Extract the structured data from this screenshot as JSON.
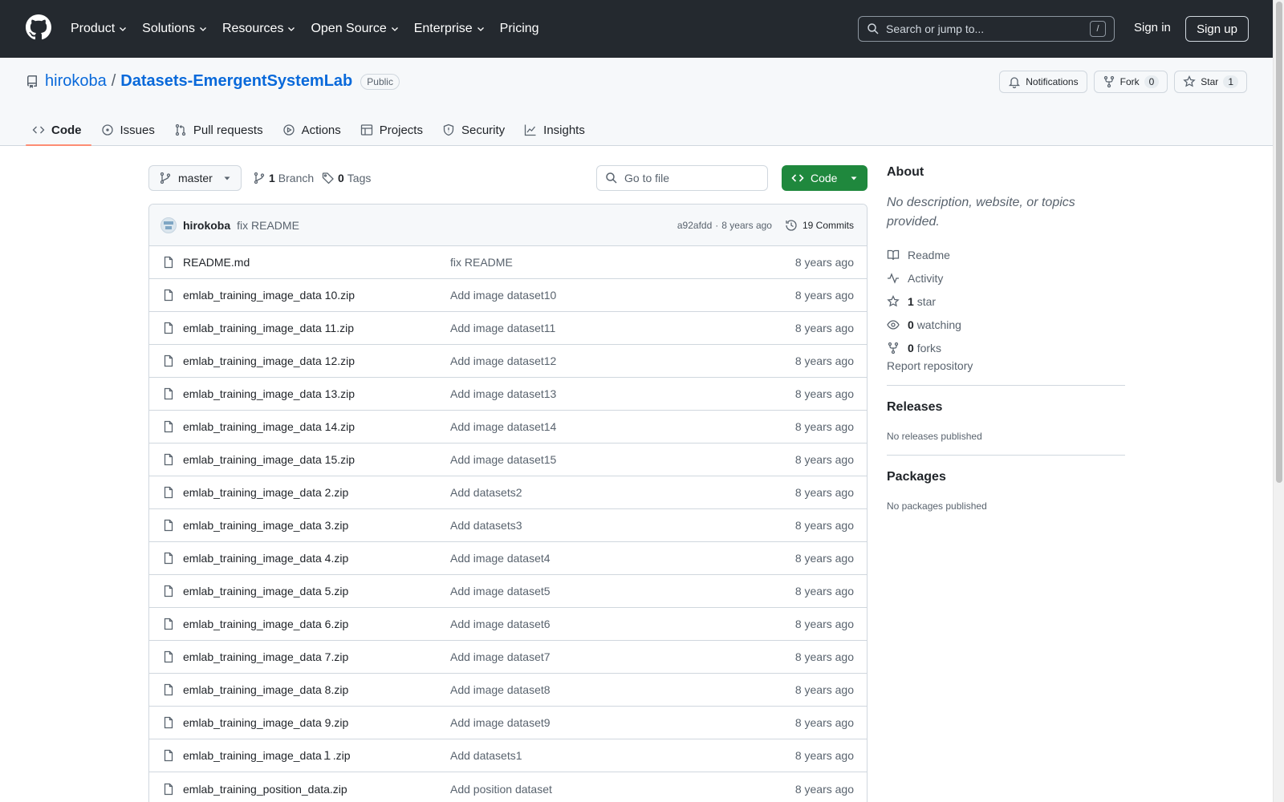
{
  "header": {
    "nav": [
      {
        "label": "Product",
        "dropdown": true
      },
      {
        "label": "Solutions",
        "dropdown": true
      },
      {
        "label": "Resources",
        "dropdown": true
      },
      {
        "label": "Open Source",
        "dropdown": true
      },
      {
        "label": "Enterprise",
        "dropdown": true
      },
      {
        "label": "Pricing",
        "dropdown": false
      }
    ],
    "search_placeholder": "Search or jump to...",
    "search_shortcut": "/",
    "sign_in": "Sign in",
    "sign_up": "Sign up"
  },
  "repo": {
    "owner": "hirokoba",
    "separator": "/",
    "name": "Datasets-EmergentSystemLab",
    "visibility": "Public",
    "actions": {
      "notifications": "Notifications",
      "fork": "Fork",
      "fork_count": "0",
      "star": "Star",
      "star_count": "1"
    },
    "tabs": [
      "Code",
      "Issues",
      "Pull requests",
      "Actions",
      "Projects",
      "Security",
      "Insights"
    ],
    "selected_tab": "Code"
  },
  "toolbar": {
    "branch": "master",
    "branch_count": "1",
    "branch_label": "Branch",
    "tag_count": "0",
    "tag_label": "Tags",
    "goto_placeholder": "Go to file",
    "code_button": "Code"
  },
  "latest_commit": {
    "author": "hirokoba",
    "message": "fix README",
    "hash": "a92afdd",
    "dot": "·",
    "time": "8 years ago",
    "commits": "19 Commits"
  },
  "files": [
    {
      "name": "README.md",
      "commit": "fix README",
      "time": "8 years ago"
    },
    {
      "name": "emlab_training_image_data 10.zip",
      "commit": "Add image dataset10",
      "time": "8 years ago"
    },
    {
      "name": "emlab_training_image_data 11.zip",
      "commit": "Add image dataset11",
      "time": "8 years ago"
    },
    {
      "name": "emlab_training_image_data 12.zip",
      "commit": "Add image dataset12",
      "time": "8 years ago"
    },
    {
      "name": "emlab_training_image_data 13.zip",
      "commit": "Add image dataset13",
      "time": "8 years ago"
    },
    {
      "name": "emlab_training_image_data 14.zip",
      "commit": "Add image dataset14",
      "time": "8 years ago"
    },
    {
      "name": "emlab_training_image_data 15.zip",
      "commit": "Add image dataset15",
      "time": "8 years ago"
    },
    {
      "name": "emlab_training_image_data 2.zip",
      "commit": "Add datasets2",
      "time": "8 years ago"
    },
    {
      "name": "emlab_training_image_data 3.zip",
      "commit": "Add datasets3",
      "time": "8 years ago"
    },
    {
      "name": "emlab_training_image_data 4.zip",
      "commit": "Add image dataset4",
      "time": "8 years ago"
    },
    {
      "name": "emlab_training_image_data 5.zip",
      "commit": "Add image dataset5",
      "time": "8 years ago"
    },
    {
      "name": "emlab_training_image_data 6.zip",
      "commit": "Add image dataset6",
      "time": "8 years ago"
    },
    {
      "name": "emlab_training_image_data 7.zip",
      "commit": "Add image dataset7",
      "time": "8 years ago"
    },
    {
      "name": "emlab_training_image_data 8.zip",
      "commit": "Add image dataset8",
      "time": "8 years ago"
    },
    {
      "name": "emlab_training_image_data 9.zip",
      "commit": "Add image dataset9",
      "time": "8 years ago"
    },
    {
      "name": "emlab_training_image_data１.zip",
      "commit": "Add datasets1",
      "time": "8 years ago"
    },
    {
      "name": "emlab_training_position_data.zip",
      "commit": "Add position dataset",
      "time": "8 years ago"
    }
  ],
  "sidebar": {
    "about_title": "About",
    "description": "No description, website, or topics provided.",
    "readme": "Readme",
    "activity": "Activity",
    "stars_count": "1",
    "stars_label": "star",
    "watching_count": "0",
    "watching_label": "watching",
    "forks_count": "0",
    "forks_label": "forks",
    "report": "Report repository",
    "releases_title": "Releases",
    "releases_text": "No releases published",
    "packages_title": "Packages",
    "packages_text": "No packages published"
  }
}
